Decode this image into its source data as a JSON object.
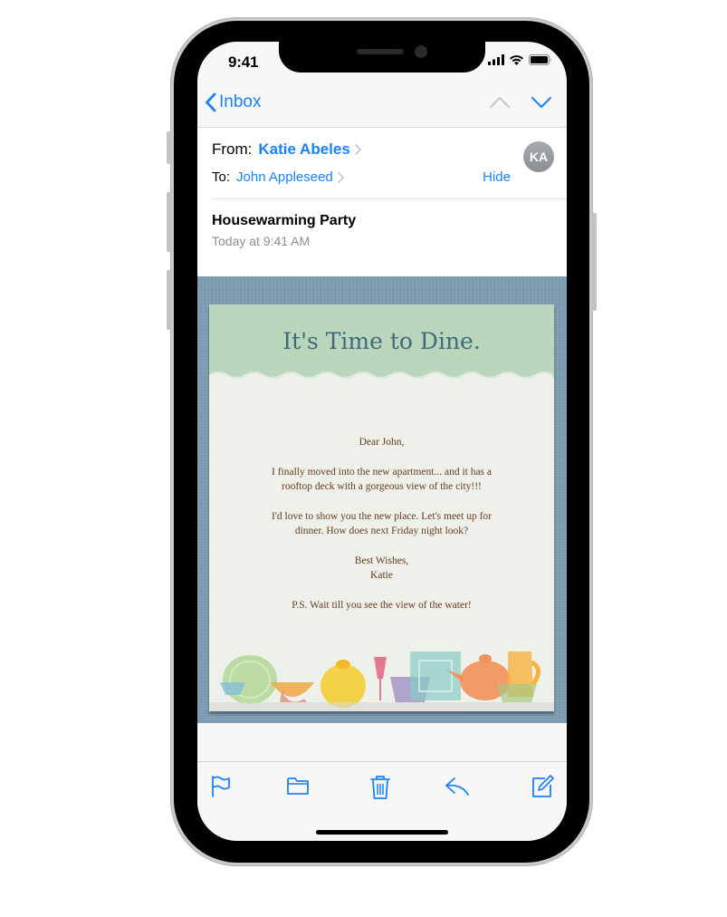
{
  "status_bar": {
    "time": "9:41"
  },
  "nav": {
    "back_label": "Inbox"
  },
  "header": {
    "from_label": "From:",
    "from_name": "Katie Abeles",
    "to_label": "To:",
    "to_name": "John Appleseed",
    "hide_label": "Hide",
    "avatar_initials": "KA"
  },
  "message": {
    "subject": "Housewarming Party",
    "date": "Today at 9:41 AM"
  },
  "card": {
    "title": "It's Time to Dine.",
    "greeting": "Dear John,",
    "para1_line1": "I finally moved into the new apartment... and it has a",
    "para1_line2": "rooftop deck with a gorgeous view of the city!!!",
    "para2_line1": "I'd love to show you the new place. Let's meet up for",
    "para2_line2": "dinner. How does next Friday night look?",
    "closing": "Best Wishes,",
    "signature": "Katie",
    "postscript": "P.S. Wait till you see the view of the water!"
  },
  "toolbar": {
    "icons": [
      "flag-icon",
      "folder-icon",
      "trash-icon",
      "reply-icon",
      "compose-icon"
    ]
  },
  "colors": {
    "accent": "#1a82fb",
    "card_header": "#b9d6bc",
    "card_title": "#3e6a7a",
    "letter_text": "#6a3a20",
    "linen_background": "#7d9db3"
  }
}
